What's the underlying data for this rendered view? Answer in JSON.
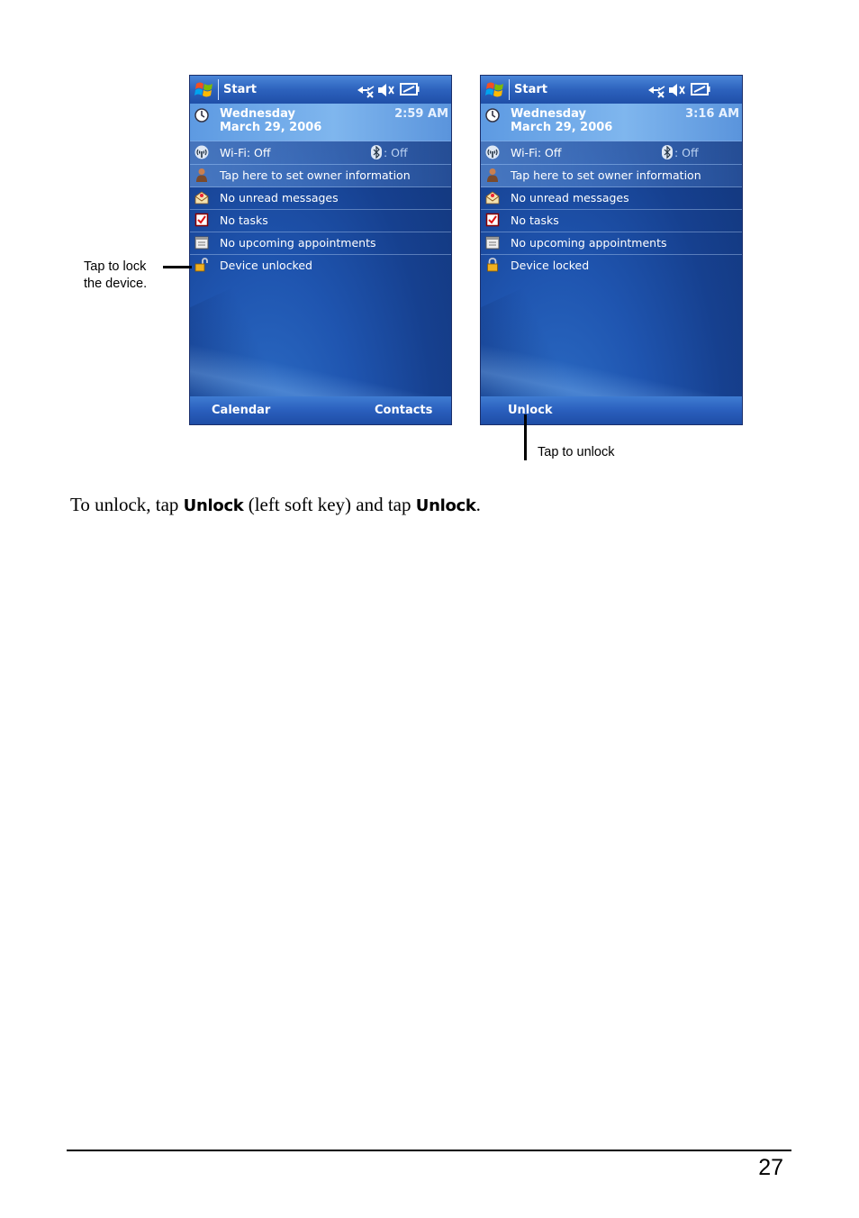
{
  "colors": {
    "screen_bg": "#1f55b0",
    "title_bar": "#2d62bd",
    "date_row": "#7fb6ee",
    "text": "#ffffff"
  },
  "screens": [
    {
      "title": "Start",
      "day": "Wednesday",
      "date": "March 29, 2006",
      "time": "2:59 AM",
      "wifi": "Wi-Fi: Off",
      "bluetooth": ": Off",
      "owner": "Tap here to set owner information",
      "messages": "No unread messages",
      "tasks": "No tasks",
      "appointments": "No upcoming appointments",
      "lock_status": "Device unlocked",
      "lock_icon": "unlocked-padlock-icon",
      "softkey_left": "Calendar",
      "softkey_right": "Contacts"
    },
    {
      "title": "Start",
      "day": "Wednesday",
      "date": "March 29, 2006",
      "time": "3:16 AM",
      "wifi": "Wi-Fi: Off",
      "bluetooth": ": Off",
      "owner": "Tap here to set owner information",
      "messages": "No unread messages",
      "tasks": "No tasks",
      "appointments": "No upcoming appointments",
      "lock_status": "Device locked",
      "lock_icon": "locked-padlock-icon",
      "softkey_left": "Unlock",
      "softkey_right": ""
    }
  ],
  "callouts": {
    "lock_line1": "Tap to lock",
    "lock_line2": "the device.",
    "unlock": "Tap to unlock"
  },
  "instruction": {
    "part1": "To unlock, tap ",
    "key1": "Unlock",
    "part2": " (left soft key) and tap ",
    "key2": "Unlock",
    "part3": "."
  },
  "page_number": "27"
}
